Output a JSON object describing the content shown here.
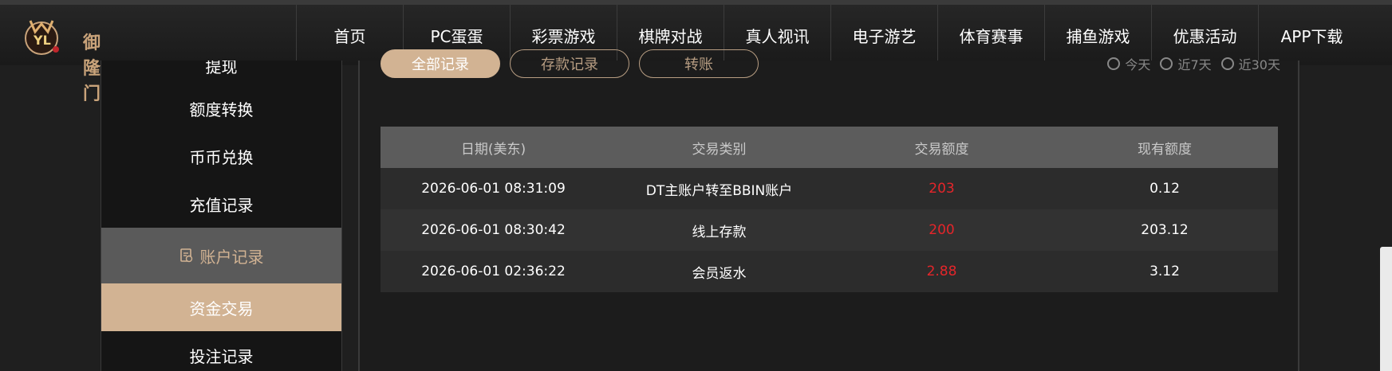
{
  "header": {
    "logo_text": "御隆门",
    "nav": [
      "首页",
      "PC蛋蛋",
      "彩票游戏",
      "棋牌对战",
      "真人视讯",
      "电子游艺",
      "体育赛事",
      "捕鱼游戏",
      "优惠活动",
      "APP下载"
    ]
  },
  "sidebar": {
    "items": [
      {
        "label": "提现",
        "state": "normal"
      },
      {
        "label": "额度转换",
        "state": "normal"
      },
      {
        "label": "币币兑换",
        "state": "normal"
      },
      {
        "label": "充值记录",
        "state": "normal"
      },
      {
        "label": "账户记录",
        "state": "hover",
        "icon": "record-icon"
      },
      {
        "label": "资金交易",
        "state": "active"
      },
      {
        "label": "投注记录",
        "state": "normal"
      }
    ]
  },
  "filters": {
    "tabs": [
      "全部记录",
      "存款记录",
      "转账"
    ],
    "ranges": [
      "今天",
      "近7天",
      "近30天"
    ]
  },
  "table": {
    "headers": [
      "日期(美东)",
      "交易类别",
      "交易额度",
      "现有额度"
    ],
    "rows": [
      {
        "date": "2026-06-01 08:31:09",
        "type": "DT主账户转至BBIN账户",
        "amount": "203",
        "balance": "0.12"
      },
      {
        "date": "2026-06-01 08:30:42",
        "type": "线上存款",
        "amount": "200",
        "balance": "203.12"
      },
      {
        "date": "2026-06-01 02:36:22",
        "type": "会员返水",
        "amount": "2.88",
        "balance": "3.12"
      }
    ]
  },
  "colors": {
    "accent": "#d2b393",
    "amount": "#e5252a",
    "header_bg": "#5c5c5c"
  }
}
